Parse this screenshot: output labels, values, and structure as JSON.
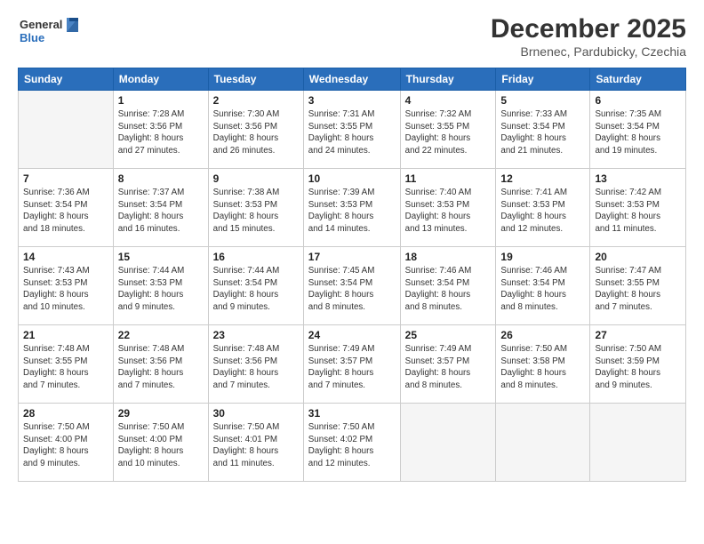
{
  "logo": {
    "line1": "General",
    "line2": "Blue"
  },
  "title": "December 2025",
  "subtitle": "Brnenec, Pardubicky, Czechia",
  "days_of_week": [
    "Sunday",
    "Monday",
    "Tuesday",
    "Wednesday",
    "Thursday",
    "Friday",
    "Saturday"
  ],
  "weeks": [
    [
      {
        "day": "",
        "info": ""
      },
      {
        "day": "1",
        "info": "Sunrise: 7:28 AM\nSunset: 3:56 PM\nDaylight: 8 hours\nand 27 minutes."
      },
      {
        "day": "2",
        "info": "Sunrise: 7:30 AM\nSunset: 3:56 PM\nDaylight: 8 hours\nand 26 minutes."
      },
      {
        "day": "3",
        "info": "Sunrise: 7:31 AM\nSunset: 3:55 PM\nDaylight: 8 hours\nand 24 minutes."
      },
      {
        "day": "4",
        "info": "Sunrise: 7:32 AM\nSunset: 3:55 PM\nDaylight: 8 hours\nand 22 minutes."
      },
      {
        "day": "5",
        "info": "Sunrise: 7:33 AM\nSunset: 3:54 PM\nDaylight: 8 hours\nand 21 minutes."
      },
      {
        "day": "6",
        "info": "Sunrise: 7:35 AM\nSunset: 3:54 PM\nDaylight: 8 hours\nand 19 minutes."
      }
    ],
    [
      {
        "day": "7",
        "info": "Sunrise: 7:36 AM\nSunset: 3:54 PM\nDaylight: 8 hours\nand 18 minutes."
      },
      {
        "day": "8",
        "info": "Sunrise: 7:37 AM\nSunset: 3:54 PM\nDaylight: 8 hours\nand 16 minutes."
      },
      {
        "day": "9",
        "info": "Sunrise: 7:38 AM\nSunset: 3:53 PM\nDaylight: 8 hours\nand 15 minutes."
      },
      {
        "day": "10",
        "info": "Sunrise: 7:39 AM\nSunset: 3:53 PM\nDaylight: 8 hours\nand 14 minutes."
      },
      {
        "day": "11",
        "info": "Sunrise: 7:40 AM\nSunset: 3:53 PM\nDaylight: 8 hours\nand 13 minutes."
      },
      {
        "day": "12",
        "info": "Sunrise: 7:41 AM\nSunset: 3:53 PM\nDaylight: 8 hours\nand 12 minutes."
      },
      {
        "day": "13",
        "info": "Sunrise: 7:42 AM\nSunset: 3:53 PM\nDaylight: 8 hours\nand 11 minutes."
      }
    ],
    [
      {
        "day": "14",
        "info": "Sunrise: 7:43 AM\nSunset: 3:53 PM\nDaylight: 8 hours\nand 10 minutes."
      },
      {
        "day": "15",
        "info": "Sunrise: 7:44 AM\nSunset: 3:53 PM\nDaylight: 8 hours\nand 9 minutes."
      },
      {
        "day": "16",
        "info": "Sunrise: 7:44 AM\nSunset: 3:54 PM\nDaylight: 8 hours\nand 9 minutes."
      },
      {
        "day": "17",
        "info": "Sunrise: 7:45 AM\nSunset: 3:54 PM\nDaylight: 8 hours\nand 8 minutes."
      },
      {
        "day": "18",
        "info": "Sunrise: 7:46 AM\nSunset: 3:54 PM\nDaylight: 8 hours\nand 8 minutes."
      },
      {
        "day": "19",
        "info": "Sunrise: 7:46 AM\nSunset: 3:54 PM\nDaylight: 8 hours\nand 8 minutes."
      },
      {
        "day": "20",
        "info": "Sunrise: 7:47 AM\nSunset: 3:55 PM\nDaylight: 8 hours\nand 7 minutes."
      }
    ],
    [
      {
        "day": "21",
        "info": "Sunrise: 7:48 AM\nSunset: 3:55 PM\nDaylight: 8 hours\nand 7 minutes."
      },
      {
        "day": "22",
        "info": "Sunrise: 7:48 AM\nSunset: 3:56 PM\nDaylight: 8 hours\nand 7 minutes."
      },
      {
        "day": "23",
        "info": "Sunrise: 7:48 AM\nSunset: 3:56 PM\nDaylight: 8 hours\nand 7 minutes."
      },
      {
        "day": "24",
        "info": "Sunrise: 7:49 AM\nSunset: 3:57 PM\nDaylight: 8 hours\nand 7 minutes."
      },
      {
        "day": "25",
        "info": "Sunrise: 7:49 AM\nSunset: 3:57 PM\nDaylight: 8 hours\nand 8 minutes."
      },
      {
        "day": "26",
        "info": "Sunrise: 7:50 AM\nSunset: 3:58 PM\nDaylight: 8 hours\nand 8 minutes."
      },
      {
        "day": "27",
        "info": "Sunrise: 7:50 AM\nSunset: 3:59 PM\nDaylight: 8 hours\nand 9 minutes."
      }
    ],
    [
      {
        "day": "28",
        "info": "Sunrise: 7:50 AM\nSunset: 4:00 PM\nDaylight: 8 hours\nand 9 minutes."
      },
      {
        "day": "29",
        "info": "Sunrise: 7:50 AM\nSunset: 4:00 PM\nDaylight: 8 hours\nand 10 minutes."
      },
      {
        "day": "30",
        "info": "Sunrise: 7:50 AM\nSunset: 4:01 PM\nDaylight: 8 hours\nand 11 minutes."
      },
      {
        "day": "31",
        "info": "Sunrise: 7:50 AM\nSunset: 4:02 PM\nDaylight: 8 hours\nand 12 minutes."
      },
      {
        "day": "",
        "info": ""
      },
      {
        "day": "",
        "info": ""
      },
      {
        "day": "",
        "info": ""
      }
    ]
  ]
}
